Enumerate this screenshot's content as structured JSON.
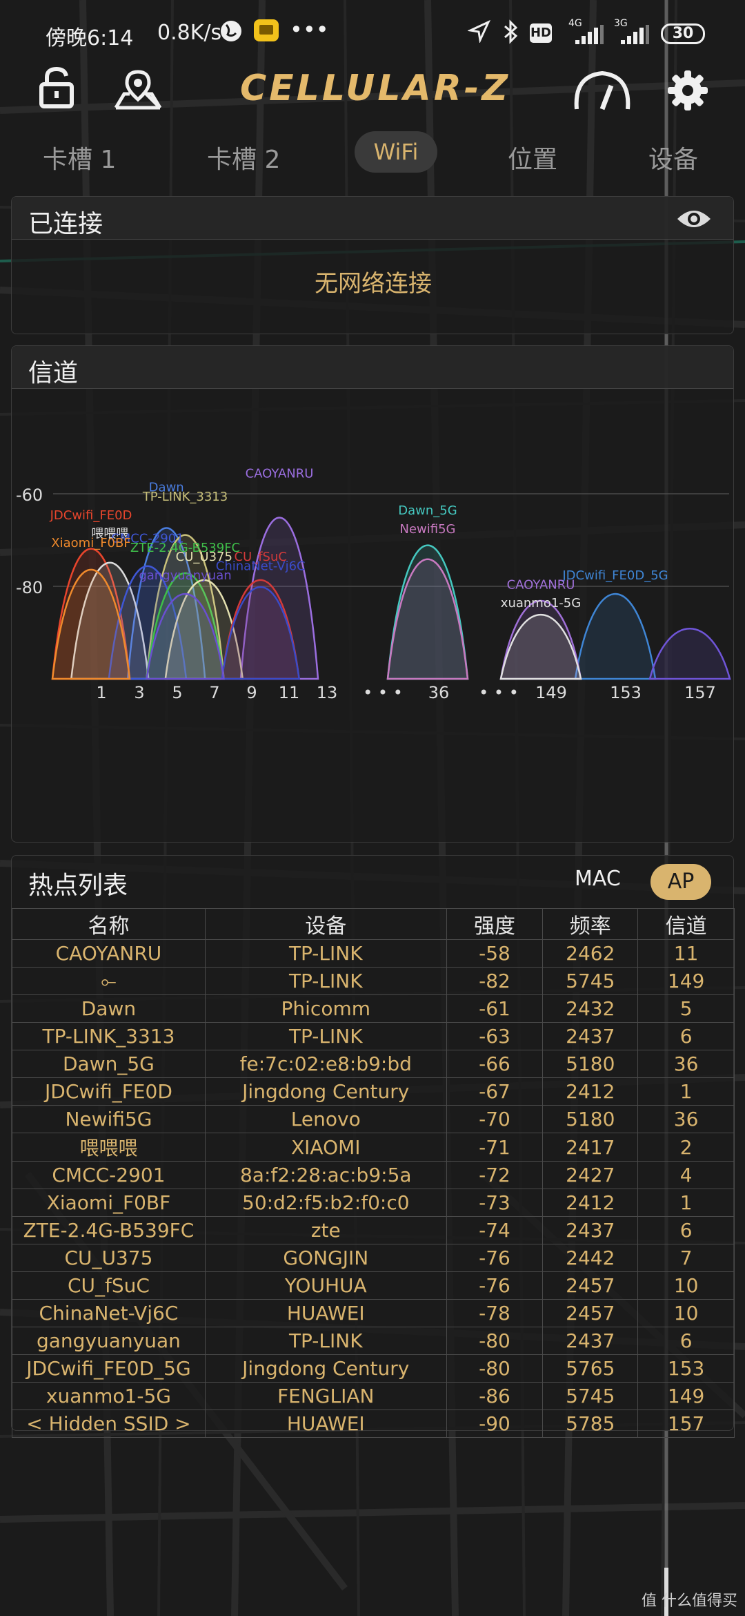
{
  "status_bar": {
    "time": "傍晚6:14",
    "speed": "0.8K/s",
    "net1": "4G",
    "net2": "3G",
    "battery": "30"
  },
  "header": {
    "app_title": "CELLULAR-Z",
    "tabs": [
      "卡槽 1",
      "卡槽 2",
      "WiFi",
      "位置",
      "设备"
    ],
    "active_tab": "WiFi"
  },
  "connected": {
    "title": "已连接",
    "message": "无网络连接"
  },
  "channel": {
    "title": "信道",
    "y_ticks": [
      "-60",
      "-80"
    ],
    "x_ticks": [
      "1",
      "3",
      "5",
      "7",
      "9",
      "11",
      "13",
      "• • •",
      "36",
      "• • •",
      "149",
      "153",
      "157"
    ]
  },
  "chart_data": {
    "type": "area",
    "title": "信道",
    "ylim": [
      -100,
      -50
    ],
    "series": [
      {
        "name": "CAOYANRU",
        "channel": 11,
        "rssi": -58,
        "color": "#9b6ee0"
      },
      {
        "name": "Dawn",
        "channel": 5,
        "rssi": -61,
        "color": "#4a7de0"
      },
      {
        "name": "TP-LINK_3313",
        "channel": 6,
        "rssi": -63,
        "color": "#c8c07a"
      },
      {
        "name": "Dawn_5G",
        "channel": 36,
        "rssi": -66,
        "color": "#45c8c0"
      },
      {
        "name": "JDCwifi_FE0D",
        "channel": 1,
        "rssi": -67,
        "color": "#e8452c"
      },
      {
        "name": "Newifi5G",
        "channel": 36,
        "rssi": -70,
        "color": "#c879c0"
      },
      {
        "name": "喂喂喂",
        "channel": 2,
        "rssi": -71,
        "color": "#dcdcdc"
      },
      {
        "name": "CMCC-2901",
        "channel": 4,
        "rssi": -72,
        "color": "#3f57d6"
      },
      {
        "name": "Xiaomi_F0BF",
        "channel": 1,
        "rssi": -73,
        "color": "#f08a2c"
      },
      {
        "name": "ZTE-2.4G-B539FC",
        "channel": 6,
        "rssi": -74,
        "color": "#3fbf4a"
      },
      {
        "name": "CU_U375",
        "channel": 7,
        "rssi": -76,
        "color": "#e4e0b0"
      },
      {
        "name": "CU_fSuC",
        "channel": 10,
        "rssi": -76,
        "color": "#d23a3a"
      },
      {
        "name": "ChinaNet-Vj6C",
        "channel": 10,
        "rssi": -78,
        "color": "#3a4bc8"
      },
      {
        "name": "gangyuanyuan",
        "channel": 6,
        "rssi": -80,
        "color": "#6a4fd0"
      },
      {
        "name": "JDCwifi_FE0D_5G",
        "channel": 153,
        "rssi": -80,
        "color": "#3f86d6"
      },
      {
        "name": "CAOYANRU",
        "channel": 149,
        "rssi": -82,
        "color": "#a070d8"
      },
      {
        "name": "xuanmo1-5G",
        "channel": 149,
        "rssi": -86,
        "color": "#e0e0e0"
      },
      {
        "name": "",
        "channel": 157,
        "rssi": -90,
        "color": "#6f55d8"
      }
    ]
  },
  "hotspot_list": {
    "title": "热点列表",
    "mac_label": "MAC",
    "ap_label": "AP",
    "headers": [
      "名称",
      "设备",
      "强度",
      "频率",
      "信道"
    ],
    "rows": [
      [
        "CAOYANRU",
        "TP-LINK",
        "-58",
        "2462",
        "11"
      ],
      [
        "⟜",
        "TP-LINK",
        "-82",
        "5745",
        "149"
      ],
      [
        "Dawn",
        "Phicomm",
        "-61",
        "2432",
        "5"
      ],
      [
        "TP-LINK_3313",
        "TP-LINK",
        "-63",
        "2437",
        "6"
      ],
      [
        "Dawn_5G",
        "fe:7c:02:e8:b9:bd",
        "-66",
        "5180",
        "36"
      ],
      [
        "JDCwifi_FE0D",
        "Jingdong Century",
        "-67",
        "2412",
        "1"
      ],
      [
        "Newifi5G",
        "Lenovo",
        "-70",
        "5180",
        "36"
      ],
      [
        "喂喂喂",
        "XIAOMI",
        "-71",
        "2417",
        "2"
      ],
      [
        "CMCC-2901",
        "8a:f2:28:ac:b9:5a",
        "-72",
        "2427",
        "4"
      ],
      [
        "Xiaomi_F0BF",
        "50:d2:f5:b2:f0:c0",
        "-73",
        "2412",
        "1"
      ],
      [
        "ZTE-2.4G-B539FC",
        "zte",
        "-74",
        "2437",
        "6"
      ],
      [
        "CU_U375",
        "GONGJIN",
        "-76",
        "2442",
        "7"
      ],
      [
        "CU_fSuC",
        "YOUHUA",
        "-76",
        "2457",
        "10"
      ],
      [
        "ChinaNet-Vj6C",
        "HUAWEI",
        "-78",
        "2457",
        "10"
      ],
      [
        "gangyuanyuan",
        "TP-LINK",
        "-80",
        "2437",
        "6"
      ],
      [
        "JDCwifi_FE0D_5G",
        "Jingdong Century",
        "-80",
        "5765",
        "153"
      ],
      [
        "xuanmo1-5G",
        "FENGLIAN",
        "-86",
        "5745",
        "149"
      ],
      [
        "< Hidden SSID >",
        "HUAWEI",
        "-90",
        "5785",
        "157"
      ]
    ]
  },
  "footer": {
    "watermark": "值 什么值得买"
  }
}
